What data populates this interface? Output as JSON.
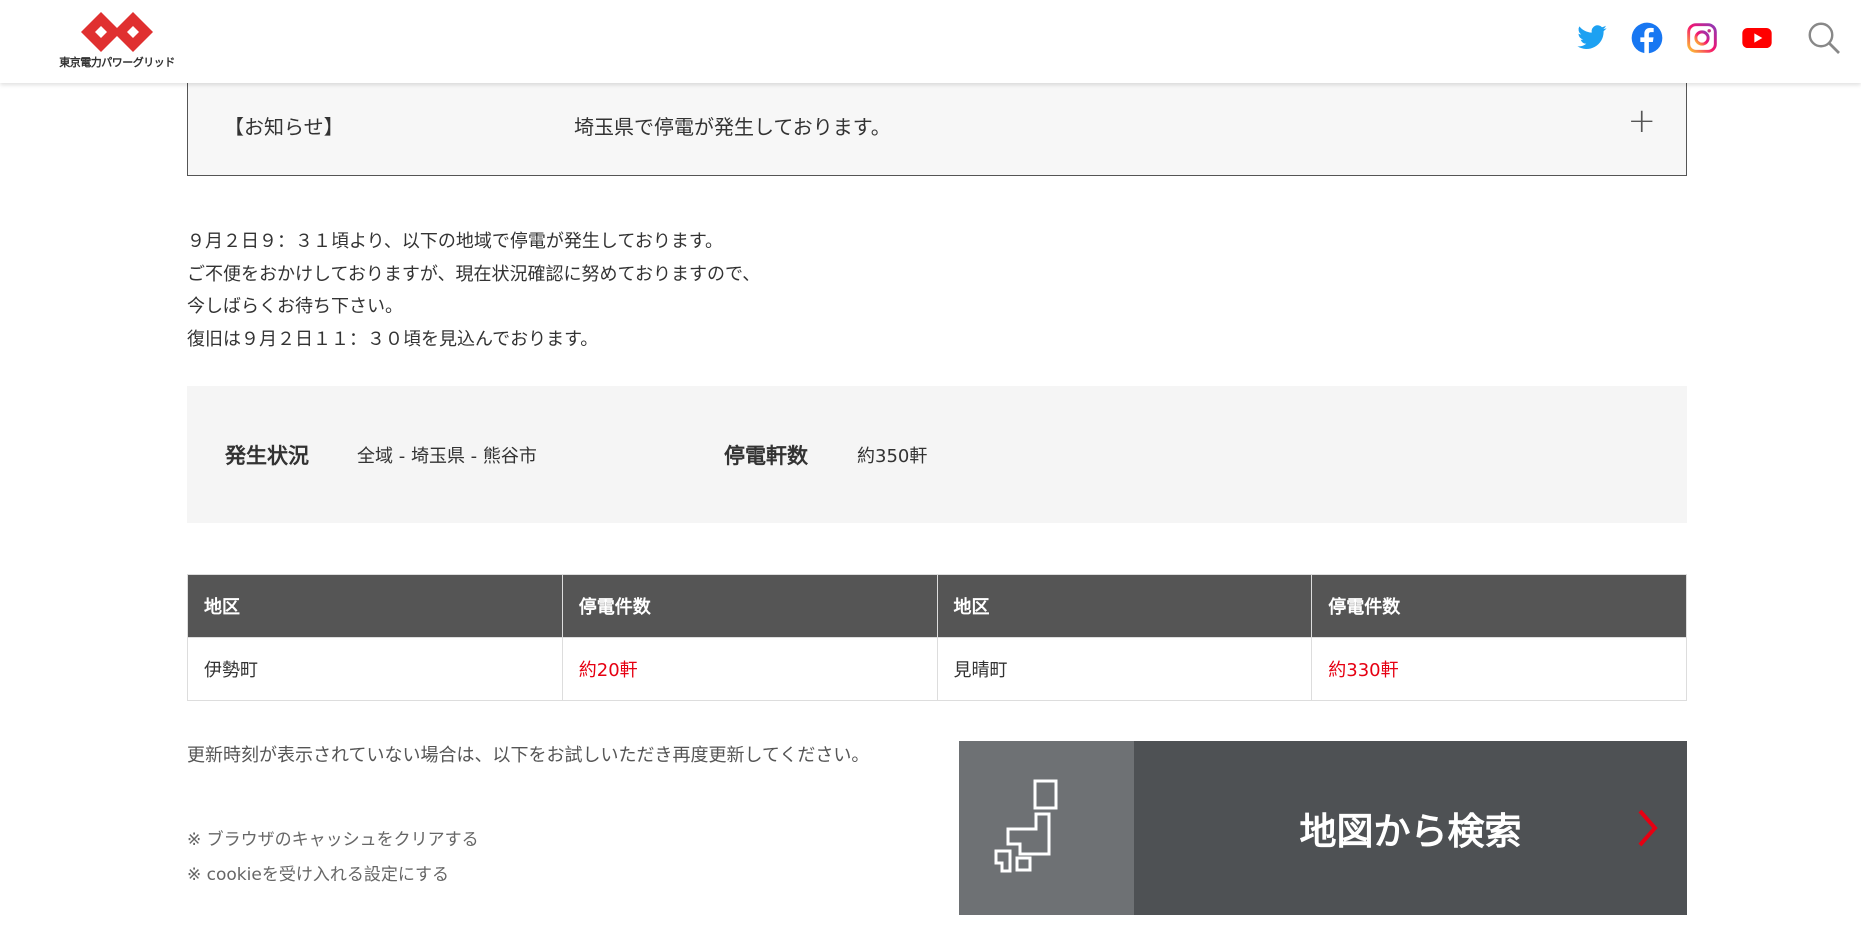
{
  "header": {
    "logo_text": "東京電力パワーグリッド",
    "icons": [
      "twitter-icon",
      "facebook-icon",
      "instagram-icon",
      "youtube-icon",
      "search-icon"
    ]
  },
  "notice": {
    "label": "【お知らせ】",
    "title": "埼玉県で停電が発生しております。",
    "expand": "+"
  },
  "message": [
    "９月２日９：３１頃より、以下の地域で停電が発生しております。",
    "ご不便をおかけしておりますが、現在状況確認に努めておりますので、",
    "今しばらくお待ち下さい。",
    "復旧は９月２日１１：３０頃を見込んでおります。"
  ],
  "status": {
    "occurrence_label": "発生状況",
    "occurrence_value": "全域 - 埼玉県 - 熊谷市",
    "count_label": "停電軒数",
    "count_value": "約350軒"
  },
  "table": {
    "headers": [
      "地区",
      "停電件数",
      "地区",
      "停電件数"
    ],
    "rows": [
      [
        "伊勢町",
        "約20軒",
        "見晴町",
        "約330軒"
      ]
    ]
  },
  "help": {
    "text": "更新時刻が表示されていない場合は、以下をお試しいただき再度更新してください。",
    "links": [
      "※ ブラウザのキャッシュをクリアする",
      "※ cookieを受け入れる設定にする"
    ]
  },
  "map_button": {
    "label": "地図から検索"
  },
  "colors": {
    "accent": "#e60012",
    "header_bg": "#555555",
    "button_bg": "#4e5154"
  }
}
